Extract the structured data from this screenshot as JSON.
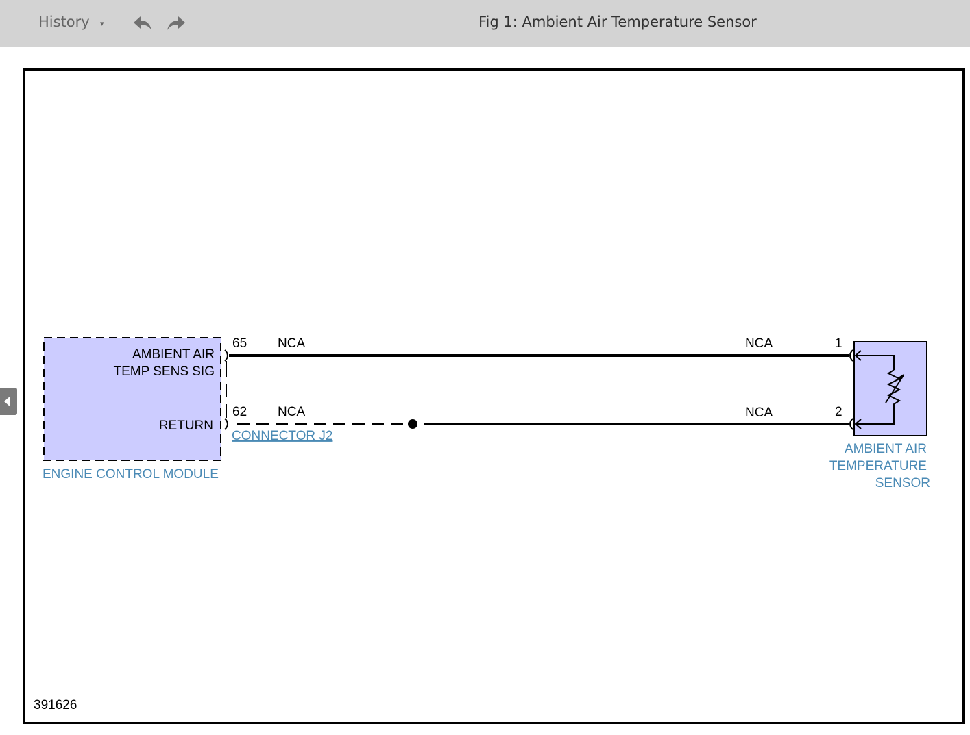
{
  "toolbar": {
    "history_label": "History",
    "history_caret": "▾",
    "back_icon": "undo-arrow-icon",
    "forward_icon": "redo-arrow-icon",
    "title": "Fig 1: Ambient Air Temperature Sensor"
  },
  "diagram": {
    "ecm": {
      "signal_line1": "AMBIENT AIR",
      "signal_line2": "TEMP SENS SIG",
      "return_label": "RETURN",
      "module_name": "ENGINE CONTROL MODULE"
    },
    "wires": [
      {
        "ecm_pin": "65",
        "ecm_color": "NCA",
        "sensor_color": "NCA",
        "sensor_pin": "1"
      },
      {
        "ecm_pin": "62",
        "ecm_color": "NCA",
        "sensor_color": "NCA",
        "sensor_pin": "2"
      }
    ],
    "connector_link": "CONNECTOR J2",
    "sensor": {
      "line1": "AMBIENT AIR",
      "line2": "TEMPERATURE",
      "line3": "SENSOR"
    },
    "figure_id": "391626"
  },
  "colors": {
    "module_fill": "#ccccff",
    "link_blue": "#4a8ab5",
    "toolbar_bg": "#d3d3d3"
  }
}
